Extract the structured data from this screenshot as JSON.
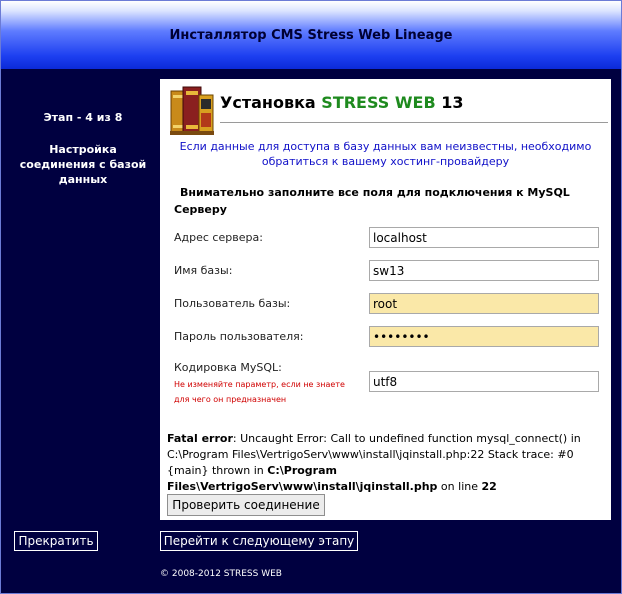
{
  "header": {
    "title": "Инсталлятор CMS Stress Web Lineage"
  },
  "sidebar": {
    "step": "Этап - 4 из 8",
    "description": "Настройка соединения с базой данных"
  },
  "panel": {
    "title_prefix": "Установка ",
    "title_brand": "STRESS WEB",
    "title_suffix": " 13",
    "notice": "Если данные для доступа в базу данных вам неизвестны, необходимо обратиться к вашему хостинг-провайдеру",
    "instruction": "Внимательно заполните все поля для подключения к MySQL Серверу"
  },
  "form": {
    "server_label": "Адрес сервера:",
    "server_value": "localhost",
    "dbname_label": "Имя базы:",
    "dbname_value": "sw13",
    "user_label": "Пользователь базы:",
    "user_value": "root",
    "password_label": "Пароль пользователя:",
    "password_value": "••••••••",
    "charset_label": "Кодировка MySQL:",
    "charset_hint": "Не изменяйте параметр, если не знаете для чего он предназначен",
    "charset_value": "utf8"
  },
  "error": {
    "label": "Fatal error",
    "message": ": Uncaught Error: Call to undefined function mysql_connect() in C:\\Program Files\\VertrigoServ\\www\\install\\jqinstall.php:22 Stack trace: #0 {main} thrown in ",
    "file": "C:\\Program Files\\VertrigoServ\\www\\install\\jqinstall.php",
    "line_text": " on line ",
    "line": "22"
  },
  "buttons": {
    "check": "Проверить соединение",
    "cancel": "Прекратить",
    "next": "Перейти к следующему этапу"
  },
  "footer": {
    "copyright": "© 2008-2012 STRESS WEB"
  },
  "colors": {
    "accent_green": "#1e8a1e",
    "notice_blue": "#1010c8",
    "frame_navy": "#000040",
    "autofill_yellow": "#fae8a8"
  },
  "icons": {
    "logo": "books-logo-icon"
  }
}
